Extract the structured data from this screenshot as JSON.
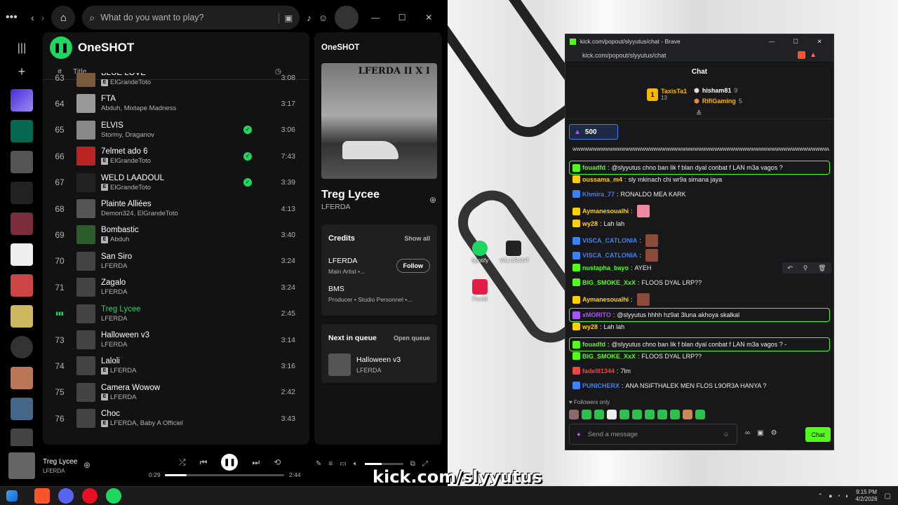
{
  "spotify": {
    "search_placeholder": "What do you want to play?",
    "playlist_title": "OneSHOT",
    "col_number": "#",
    "col_title": "Title",
    "tracks": [
      {
        "n": "63",
        "title": "BLUE LOVE",
        "artist": "ElGrandeToto",
        "explicit": true,
        "saved": false,
        "dur": "3:08"
      },
      {
        "n": "64",
        "title": "FTA",
        "artist": "Abduh, Mixtape Madness",
        "explicit": false,
        "saved": false,
        "dur": "3:17"
      },
      {
        "n": "65",
        "title": "ELVIS",
        "artist": "Stormy, Draganov",
        "explicit": false,
        "saved": true,
        "dur": "3:06"
      },
      {
        "n": "66",
        "title": "7elmet ado 6",
        "artist": "ElGrandeToto",
        "explicit": true,
        "saved": true,
        "dur": "7:43"
      },
      {
        "n": "67",
        "title": "WELD LAADOUL",
        "artist": "ElGrandeToto",
        "explicit": true,
        "saved": true,
        "dur": "3:39"
      },
      {
        "n": "68",
        "title": "Plainte Alliées",
        "artist": "Demon324, ElGrandeToto",
        "explicit": false,
        "saved": false,
        "dur": "4:13"
      },
      {
        "n": "69",
        "title": "Bombastic",
        "artist": "Abduh",
        "explicit": true,
        "saved": false,
        "dur": "3:40"
      },
      {
        "n": "70",
        "title": "San Siro",
        "artist": "LFERDA",
        "explicit": false,
        "saved": false,
        "dur": "3:24"
      },
      {
        "n": "71",
        "title": "Zagalo",
        "artist": "LFERDA",
        "explicit": false,
        "saved": false,
        "dur": "3:24"
      },
      {
        "n": "",
        "title": "Treg Lycee",
        "artist": "LFERDA",
        "explicit": false,
        "saved": false,
        "dur": "2:45",
        "playing": true
      },
      {
        "n": "73",
        "title": "Halloween v3",
        "artist": "LFERDA",
        "explicit": false,
        "saved": false,
        "dur": "3:14"
      },
      {
        "n": "74",
        "title": "Laloli",
        "artist": "LFERDA",
        "explicit": true,
        "saved": false,
        "dur": "3:16"
      },
      {
        "n": "75",
        "title": "Camera Wowow",
        "artist": "LFERDA",
        "explicit": true,
        "saved": false,
        "dur": "2:42"
      },
      {
        "n": "76",
        "title": "Choc",
        "artist": "LFERDA, Baby A Officiel",
        "explicit": true,
        "saved": false,
        "dur": "3:43"
      }
    ],
    "panel": {
      "header": "OneSHOT",
      "album_art_text": "LFERDA II X I",
      "song": "Treg Lycee",
      "artist": "LFERDA",
      "credits_title": "Credits",
      "show_all": "Show all",
      "credit1_name": "LFERDA",
      "credit1_role": "Main Artist •...",
      "follow": "Follow",
      "credit2_name": "BMS",
      "credit2_role": "Producer • Studio Personnel •...",
      "next_title": "Next in queue",
      "open_queue": "Open queue",
      "next_song": "Halloween v3",
      "next_artist": "LFERDA"
    },
    "player": {
      "song": "Treg Lycee",
      "artist": "LFERDA",
      "elapsed": "0:29",
      "total": "2:44",
      "progress": 0.18,
      "volume": 0.45
    }
  },
  "kick": {
    "window_title": "kick.com/popout/slyyutus/chat - Brave",
    "url": "kick.com/popout/slyyutus/chat",
    "chat_header": "Chat",
    "leaders": [
      {
        "name": "TaxisTa1",
        "count": "13",
        "rank": "1"
      },
      {
        "name": "hisham81",
        "count": "9"
      },
      {
        "name": "RifiGaming",
        "count": "5"
      }
    ],
    "pinned_amount": "500",
    "spam_line": "wwwwwwwwwwwwwwwwwwwwwwwwwwwwwwwwwwwwwwwwwwwwwwwwwwwwwwwwwwwwwwwwwwww",
    "messages": [
      {
        "user": "fouadfd",
        "color": "#53fc18",
        "text": "@slyyutus chno ban lik f blan dyal conbat f LAN m3a vagos ?",
        "hl": true
      },
      {
        "user": "oussama_m4",
        "color": "#ffd000",
        "text": "sly mkinach chi wr9a simana jaya"
      },
      {
        "user": "Khmira_77",
        "color": "#3b82f6",
        "text": "RONALDO MEA KARK"
      },
      {
        "user": "Aymanesoualhi",
        "color": "#ffd000",
        "text": ""
      },
      {
        "user": "wy28",
        "color": "#ffd000",
        "text": "Lah lah"
      },
      {
        "user": "VISCA_CATLONIA",
        "color": "#3b82f6",
        "text": ""
      },
      {
        "user": "VISCA_CATLONIA",
        "color": "#3b82f6",
        "text": ""
      },
      {
        "user": "nustapha_bayo",
        "color": "#53fc18",
        "text": "AYEH"
      },
      {
        "user": "BIG_SMOKE_XxX",
        "color": "#53fc18",
        "text": "FLOOS DYAL LRP??"
      },
      {
        "user": "Aymanesoualhi",
        "color": "#ffd000",
        "text": ""
      },
      {
        "user": "xMORITO",
        "color": "#a855f7",
        "text": "@slyyutus hhhh hz9at 3luna akhoya skalkal",
        "hl": true
      },
      {
        "user": "wy28",
        "color": "#ffd000",
        "text": "Lah lah"
      },
      {
        "user": "fouadfd",
        "color": "#53fc18",
        "text": "@slyyutus chno ban lik f blan dyal conbat f LAN m3a vagos ? -",
        "hl": true
      },
      {
        "user": "BIG_SMOKE_XxX",
        "color": "#53fc18",
        "text": "FLOOS DYAL LRP??"
      },
      {
        "user": "fadelll1344",
        "color": "#ef4444",
        "text": "7lm"
      },
      {
        "user": "PUNICHERX",
        "color": "#3b82f6",
        "text": "ANA NSIFTHALEK MEN FLOS L9OR3A HANYA ?"
      }
    ],
    "followers_only": "Followers only",
    "input_placeholder": "Send a message",
    "chat_button": "Chat"
  },
  "desktop": {
    "icon1": "Spotify",
    "icon2": "VALORANT",
    "icon3": "FiveM"
  },
  "watermark": "kick.com/slyyutus",
  "taskbar": {
    "time": "9:15 PM",
    "date": "4/2/2026"
  }
}
